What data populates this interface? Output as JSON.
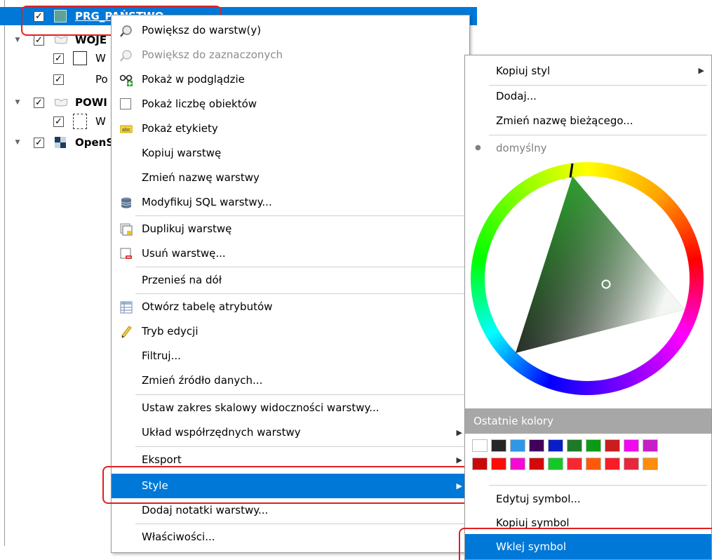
{
  "tree": {
    "layers": [
      {
        "name": "PRG_PAŃSTWO",
        "checked": "✓",
        "selected": true,
        "bold": false
      },
      {
        "name": "WOJE",
        "checked": "✓",
        "bold": true
      },
      {
        "name": "W",
        "checked": "✓",
        "bold": false
      },
      {
        "name": "Po",
        "checked": "✓",
        "bold": false
      },
      {
        "name": "POWI",
        "checked": "✓",
        "bold": true
      },
      {
        "name": "W",
        "checked": "✓",
        "bold": false
      },
      {
        "name": "OpenS",
        "checked": "✓",
        "bold": true
      }
    ]
  },
  "context_menu": {
    "items": [
      {
        "label": "Powiększ do warstw(y)",
        "icon": "zoom-layer-icon"
      },
      {
        "label": "Powiększ do zaznaczonych",
        "icon": "zoom-selected-icon",
        "disabled": true
      },
      {
        "label": "Pokaż w podglądzie",
        "icon": "overview-icon"
      },
      {
        "label": "Pokaż liczbę obiektów",
        "icon": "checkbox-icon"
      },
      {
        "label": "Pokaż etykiety",
        "icon": "labels-icon"
      },
      {
        "label": "Kopiuj warstwę"
      },
      {
        "label": "Zmień nazwę warstwy"
      },
      {
        "label": "Modyfikuj SQL warstwy...",
        "icon": "database-icon"
      },
      {
        "label": "Duplikuj warstwę",
        "icon": "duplicate-layer-icon"
      },
      {
        "label": "Usuń warstwę...",
        "icon": "remove-layer-icon"
      },
      {
        "label": "Przenieś na dół"
      },
      {
        "label": "Otwórz tabelę atrybutów",
        "icon": "attribute-table-icon"
      },
      {
        "label": "Tryb edycji",
        "icon": "pencil-icon"
      },
      {
        "label": "Filtruj..."
      },
      {
        "label": "Zmień źródło danych..."
      },
      {
        "label": "Ustaw zakres skalowy widoczności warstwy..."
      },
      {
        "label": "Układ współrzędnych warstwy",
        "submenu": true
      },
      {
        "label": "Eksport",
        "submenu": true
      },
      {
        "label": "Style",
        "submenu": true,
        "highlighted": true
      },
      {
        "label": "Dodaj notatki warstwy..."
      },
      {
        "label": "Właściwości..."
      }
    ]
  },
  "style_submenu": {
    "copy_style": "Kopiuj styl",
    "add": "Dodaj...",
    "rename": "Zmień nazwę bieżącego...",
    "current_style": "domyślny",
    "bullet": "●",
    "recent_colors_label": "Ostatnie kolory",
    "recent_colors_row1": [
      "#ffffff",
      "#262626",
      "#2f96e8",
      "#41005a",
      "#0a1ec8",
      "#1e7a28",
      "#0a9c14",
      "#c81e1e",
      "#f00af0",
      "#c81ec8"
    ],
    "recent_colors_row2": [
      "#c80a0a",
      "#ff0a0a",
      "#f50ad2",
      "#d20a0a",
      "#14c828",
      "#f52832",
      "#ff5a0a",
      "#f51e28",
      "#e6283c",
      "#ff8c0a"
    ],
    "edit_symbol": "Edytuj symbol...",
    "copy_symbol": "Kopiuj symbol",
    "paste_symbol": "Wklej symbol"
  },
  "colors": {
    "highlight": "#0078d7",
    "annotation": "#e02020",
    "layer_fill": "#5ea29a"
  }
}
